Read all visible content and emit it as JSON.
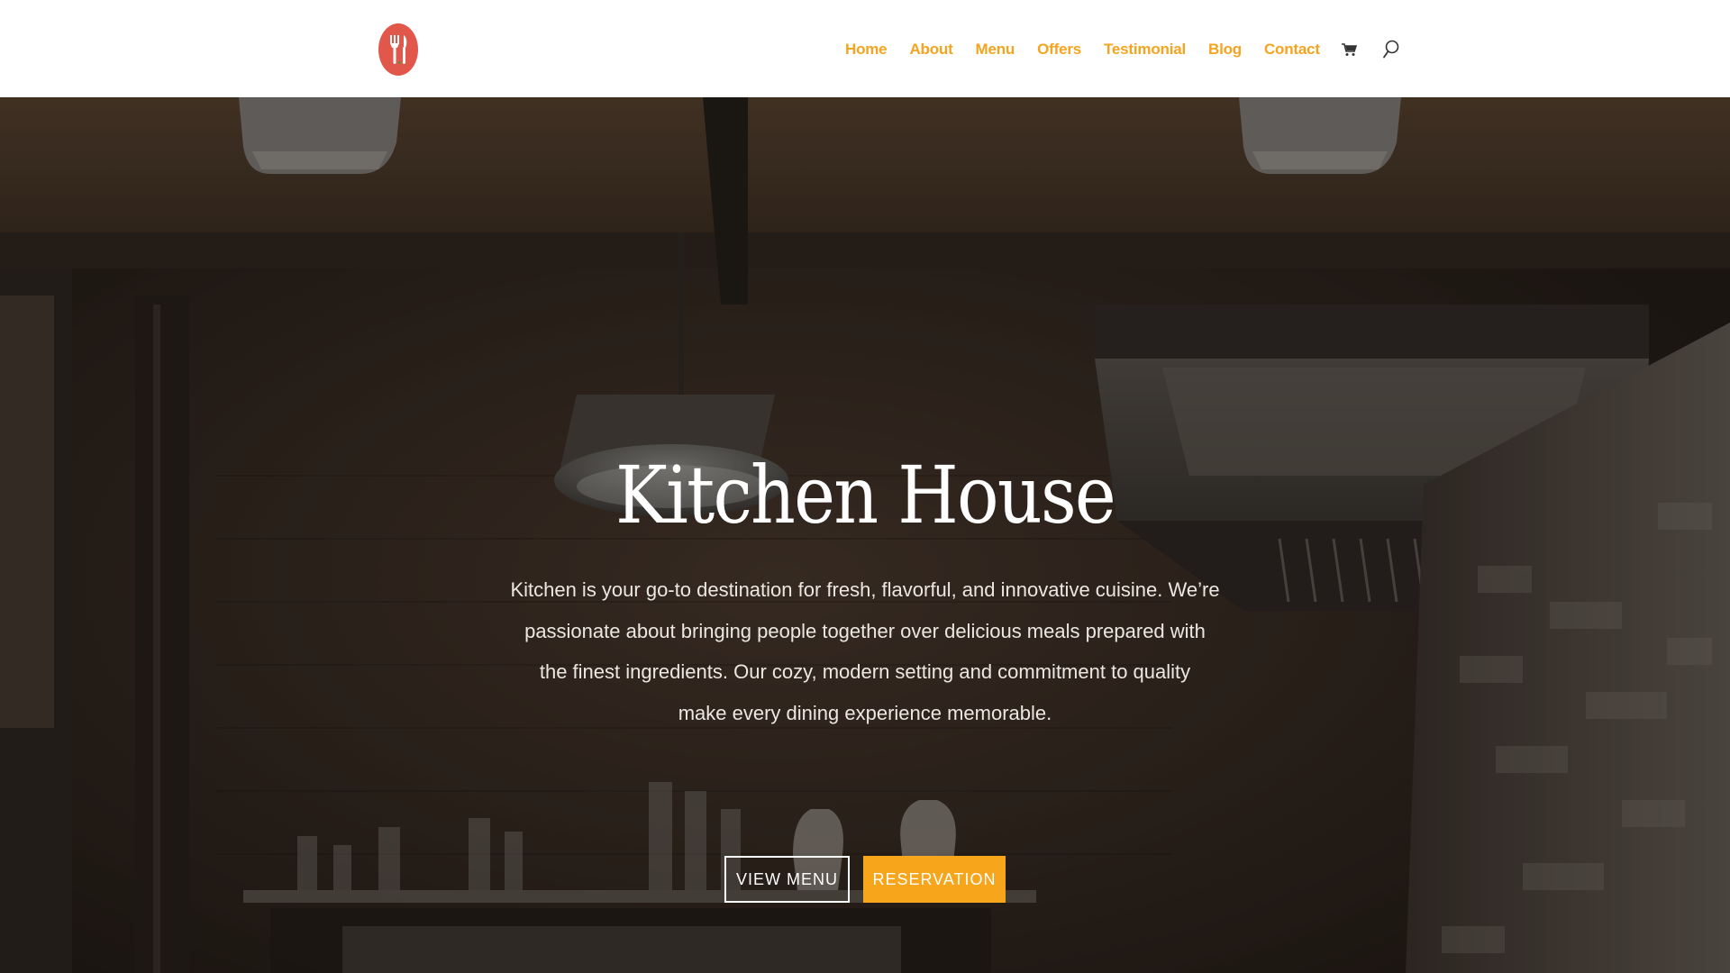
{
  "header": {
    "logo": {
      "icon": "fork-knife-icon",
      "color": "#e2574c"
    },
    "nav": [
      {
        "label": "Home"
      },
      {
        "label": "About"
      },
      {
        "label": "Menu"
      },
      {
        "label": "Offers"
      },
      {
        "label": "Testimonial"
      },
      {
        "label": "Blog"
      },
      {
        "label": "Contact"
      }
    ],
    "icons": [
      "cart-icon",
      "search-icon"
    ],
    "accent_color": "#f4a41f"
  },
  "hero": {
    "title": "Kitchen House",
    "paragraph_lines": [
      "Kitchen is your go-to destination for fresh, flavorful, and innovative cuisine. We’re",
      "passionate about bringing people together over delicious meals prepared with",
      "the finest ingredients. Our cozy, modern setting and commitment to quality",
      "make every dining experience memorable."
    ],
    "buttons": {
      "view_menu": "VIEW MENU",
      "reservation": "RESERVATION"
    },
    "reservation_color": "#f7a51a"
  }
}
